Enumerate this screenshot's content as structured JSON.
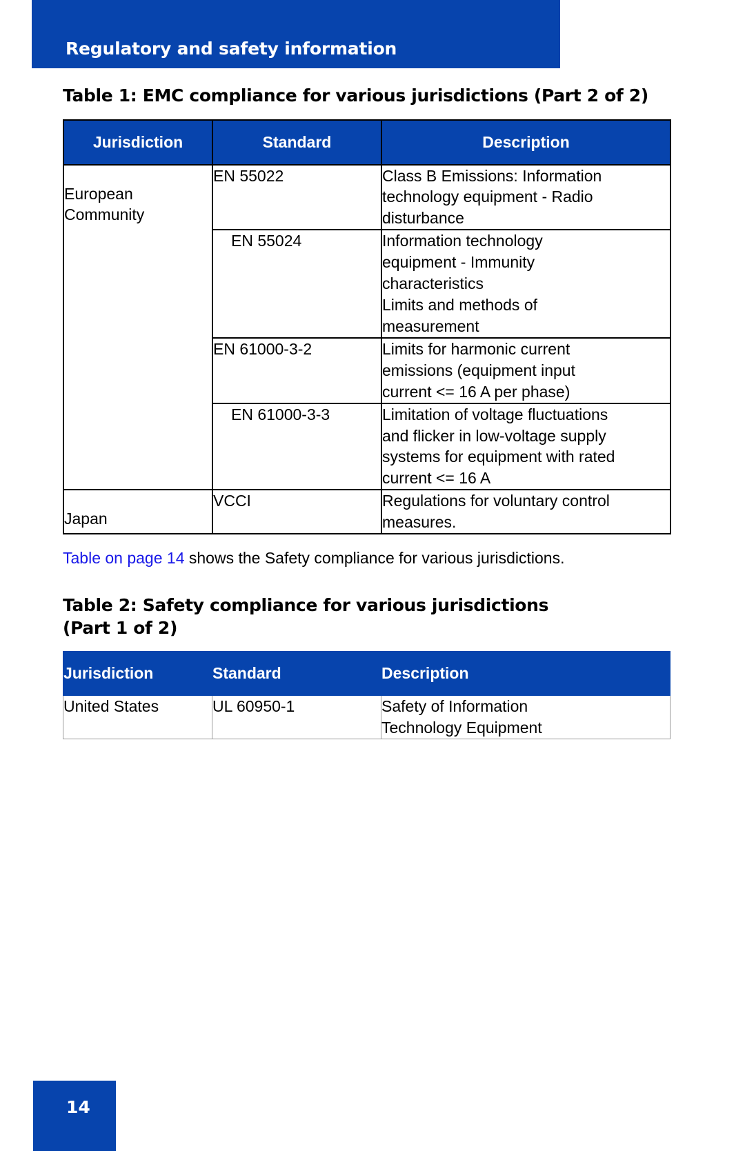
{
  "header": {
    "title": "Regulatory and safety information",
    "background_color": "#0744AD",
    "text_color": "#FFFFFF"
  },
  "colors": {
    "brand_blue": "#0744AD",
    "link_blue": "#1818E8",
    "rule_black": "#000000",
    "rule_grey": "#9A9A9A"
  },
  "table1": {
    "caption": "Table 1: EMC compliance for various jurisdictions (Part 2 of 2)",
    "columns": [
      "Jurisdiction",
      "Standard",
      "Description"
    ],
    "rows": [
      {
        "jurisdiction": "European\nCommunity",
        "standard": "EN 55022",
        "description": "Class B Emissions: Information\ntechnology equipment - Radio\ndisturbance"
      },
      {
        "jurisdiction": "",
        "standard": "EN 55024",
        "description": "Information technology\nequipment - Immunity\ncharacteristics\nLimits and methods of\nmeasurement"
      },
      {
        "jurisdiction": "",
        "standard": "EN 61000-3-2",
        "description": "Limits for harmonic current\nemissions (equipment input\ncurrent <= 16 A per phase)"
      },
      {
        "jurisdiction": "",
        "standard": "EN 61000-3-3",
        "description": "Limitation of voltage fluctuations\nand flicker in low-voltage supply\nsystems for equipment with rated\ncurrent <= 16 A"
      },
      {
        "jurisdiction": "Japan",
        "standard": "VCCI",
        "description": "Regulations for voluntary control\nmeasures."
      }
    ]
  },
  "paragraph": {
    "link_text": "Table  on page 14",
    "rest_text": " shows the Safety compliance for various jurisdictions."
  },
  "table2": {
    "caption_line1": "Table 2: Safety compliance for various jurisdictions",
    "caption_line2": "(Part 1 of 2)",
    "columns": [
      "Jurisdiction",
      "Standard",
      "Description"
    ],
    "rows": [
      {
        "jurisdiction": "United States",
        "standard": "UL 60950-1",
        "description": "Safety of Information\nTechnology Equipment"
      }
    ]
  },
  "footer": {
    "page_number": "14"
  }
}
